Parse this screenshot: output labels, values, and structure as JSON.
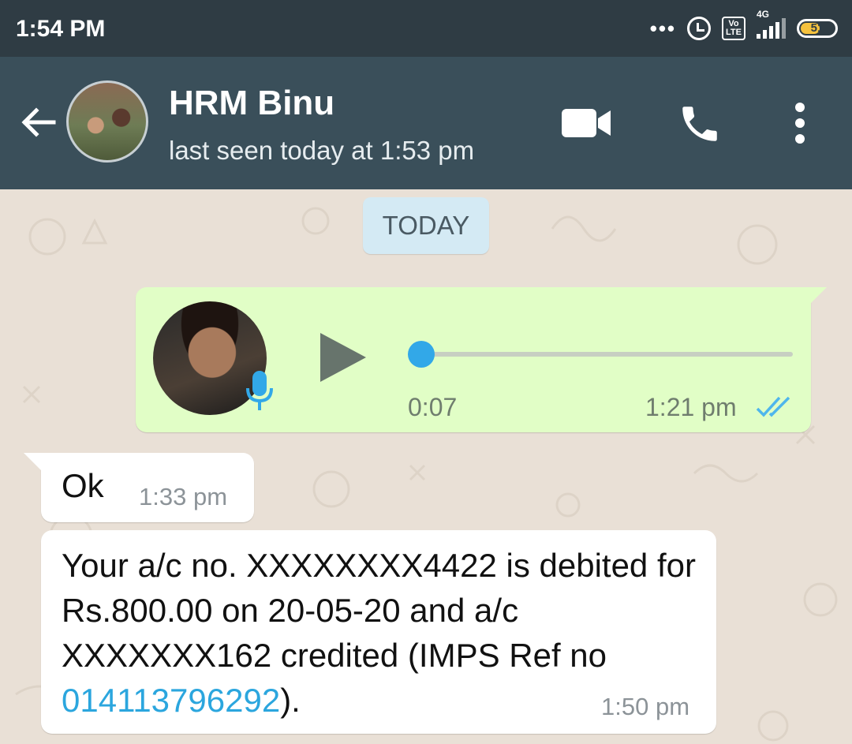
{
  "status_bar": {
    "time": "1:54 PM",
    "more": "•••",
    "volte_top": "Vo",
    "volte_bottom": "LTE",
    "network": "4G",
    "battery": "51"
  },
  "header": {
    "contact_name": "HRM Binu",
    "last_seen": "last seen today at 1:53 pm",
    "icons": [
      "back-arrow-icon",
      "video-call-icon",
      "phone-icon",
      "more-vert-icon"
    ]
  },
  "chat": {
    "date_chip": "TODAY",
    "voice_message": {
      "duration": "0:07",
      "time": "1:21 pm",
      "progress": 0
    },
    "messages": [
      {
        "text": "Ok",
        "time": "1:33 pm"
      },
      {
        "text_before": "Your a/c no. XXXXXXXX4422 is debited for Rs.800.00 on 20-05-20 and a/c XXXXXXX162 credited (IMPS Ref no ",
        "link": "014113796292",
        "text_after": ").",
        "time": "1:50 pm"
      }
    ]
  },
  "colors": {
    "status_bar": "#2f3c44",
    "app_bar": "#3a4f5a",
    "outgoing_bubble": "#e1fec6",
    "incoming_bubble": "#ffffff",
    "link": "#2ba6de",
    "accent_blue": "#32a8e8"
  }
}
